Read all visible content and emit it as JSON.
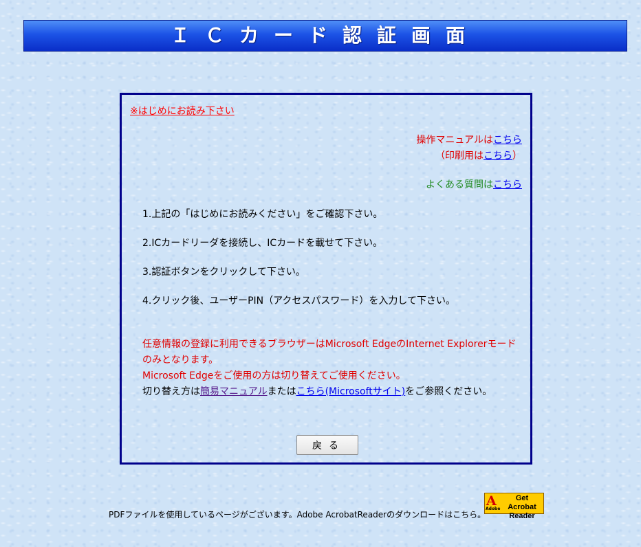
{
  "header": {
    "title": "ＩＣカード認証画面"
  },
  "notice_link": "※はじめにお読み下さい",
  "links": {
    "manual_prefix": "操作マニュアルは",
    "manual_link": "こちら",
    "print_prefix": "（印刷用は",
    "print_link": "こちら",
    "print_suffix": "）",
    "faq_prefix": "よくある質問は",
    "faq_link": "こちら"
  },
  "steps": [
    "1.上記の「はじめにお読みください」をご確認下さい。",
    "2.ICカードリーダを接続し、ICカードを載せて下さい。",
    "3.認証ボタンをクリックして下さい。",
    "4.クリック後、ユーザーPIN（アクセスパスワード）を入力して下さい。"
  ],
  "warning": {
    "line1": "任意情報の登録に利用できるブラウザーはMicrosoft EdgeのInternet Explorerモードのみとなります。",
    "line2": "Microsoft Edgeをご使用の方は切り替えてご使用ください。",
    "line3_prefix": "切り替え方は",
    "simple_manual_link": "簡易マニュアル",
    "line3_middle": "または",
    "microsoft_link": "こちら(Microsoftサイト)",
    "line3_suffix": "をご参照ください。"
  },
  "back_button": "戻る",
  "footer": {
    "text": "PDFファイルを使用しているページがございます。Adobe AcrobatReaderのダウンロードはこちら。",
    "acrobat_badge_line1": "Get Acrobat",
    "acrobat_badge_line2": "Reader",
    "acrobat_badge_brand": "Adobe"
  },
  "colors": {
    "title_bar": "#1c53e6",
    "panel_border": "#00008b",
    "red_text": "#e00000",
    "green_text": "#228b22",
    "link_blue": "#0000ee",
    "visited_purple": "#551a8b"
  }
}
